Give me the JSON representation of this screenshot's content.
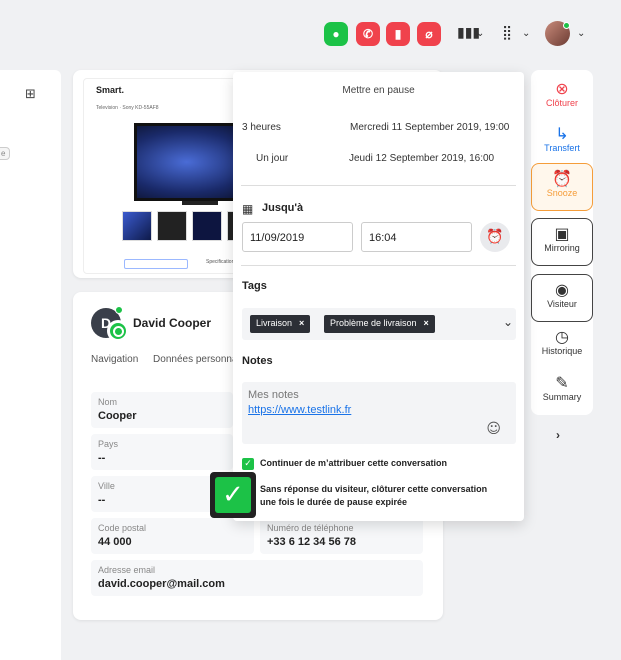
{
  "topbar": {
    "icons": [
      "chat-icon",
      "phone-off-icon",
      "video-off-icon",
      "mic-off-icon",
      "bar-chart-icon",
      "chevron-down-icon",
      "grid-icon",
      "chevron-down-icon",
      "avatar"
    ],
    "colors": {
      "green": "#1cc247",
      "red": "#f0424c"
    }
  },
  "left": {
    "badge": "e"
  },
  "product": {
    "brand": "Smart.",
    "breadcrumb": "Television · Sony KD-55AF8",
    "button2": "Specifications"
  },
  "contact": {
    "initial": "D",
    "name": "David Cooper",
    "tabs": [
      "Navigation",
      "Données personna"
    ],
    "fields": {
      "nom_label": "Nom",
      "nom": "Cooper",
      "pays_label": "Pays",
      "pays": "--",
      "ville_label": "Ville",
      "ville": "--",
      "cp_label": "Code postal",
      "cp": "44 000",
      "tel_label": "Numéro de téléphone",
      "tel": "+33 6 12 34 56 78",
      "email_label": "Adresse email",
      "email": "david.cooper@mail.com"
    }
  },
  "sidebar": {
    "close": "Clôturer",
    "transfer": "Transfert",
    "snooze": "Snooze",
    "mirroring": "Mirroring",
    "visitor": "Visiteur",
    "history": "Historique",
    "summary": "Summary",
    "snooze_color": "#f59d3a",
    "close_color": "#f0424c",
    "transfer_color": "#1a73e8"
  },
  "popup": {
    "title": "Mettre en pause",
    "option1_label": "3 heures",
    "option1_date": "Mercredi 11 September 2019, 19:00",
    "option2_label": "Un jour",
    "option2_date": "Jeudi 12 September 2019, 16:00",
    "until_label": "Jusqu'à",
    "date_value": "11/09/2019",
    "time_value": "16:04",
    "tags_label": "Tags",
    "tags": [
      "Livraison",
      "Problème de livraison"
    ],
    "notes_label": "Notes",
    "notes_placeholder": "Mes notes",
    "notes_link": "https://www.testlink.fr",
    "checkbox1_label": "Continuer de m’attribuer cette conversation",
    "checkbox2_label_line1": "Sans réponse du visiteur, clôturer cette conversation",
    "checkbox2_label_line2": "une fois le durée de pause expirée"
  }
}
